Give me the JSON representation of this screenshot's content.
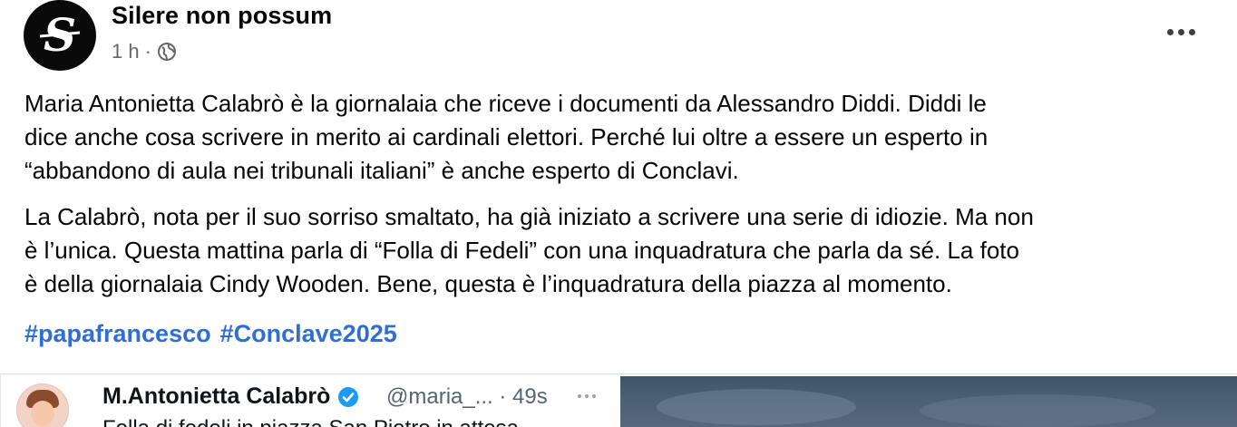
{
  "post": {
    "page_name": "Silere non possum",
    "time": "1 h",
    "separator": "·",
    "privacy_icon": "globe-icon",
    "more_icon": "more-horizontal-icon",
    "paragraphs": [
      "Maria Antonietta Calabrò è la giornalaia che riceve i documenti da Alessandro Diddi. Diddi le\ndice anche cosa scrivere in merito ai cardinali elettori. Perché lui oltre a essere un esperto in\n“abbandono di aula nei tribunali italiani” è anche esperto di Conclavi.",
      "La Calabrò, nota per il suo sorriso smaltato, ha già iniziato a scrivere una serie di idiozie. Ma non\nè l’unica. Questa mattina parla di “Folla di Fedeli” con una inquadratura che parla da sé. La foto\nè della giornalaia Cindy Wooden. Bene, questa è l’inquadratura della piazza al momento."
    ],
    "hashtags": [
      "#papafrancesco",
      "#Conclave2025"
    ]
  },
  "embed": {
    "tweet": {
      "author": "M.Antonietta Calabrò",
      "handle_time": "@maria_... · 49s",
      "text": "Folla di fedeli in piazza San Pietro in attesa",
      "verified_icon": "verified-badge-icon",
      "more_icon": "more-horizontal-icon"
    }
  },
  "colors": {
    "hashtag": "#2f6fd3",
    "secondary_text": "#65676b",
    "avatar_bg": "#0a0a0a",
    "verified": "#1d9bf0"
  }
}
